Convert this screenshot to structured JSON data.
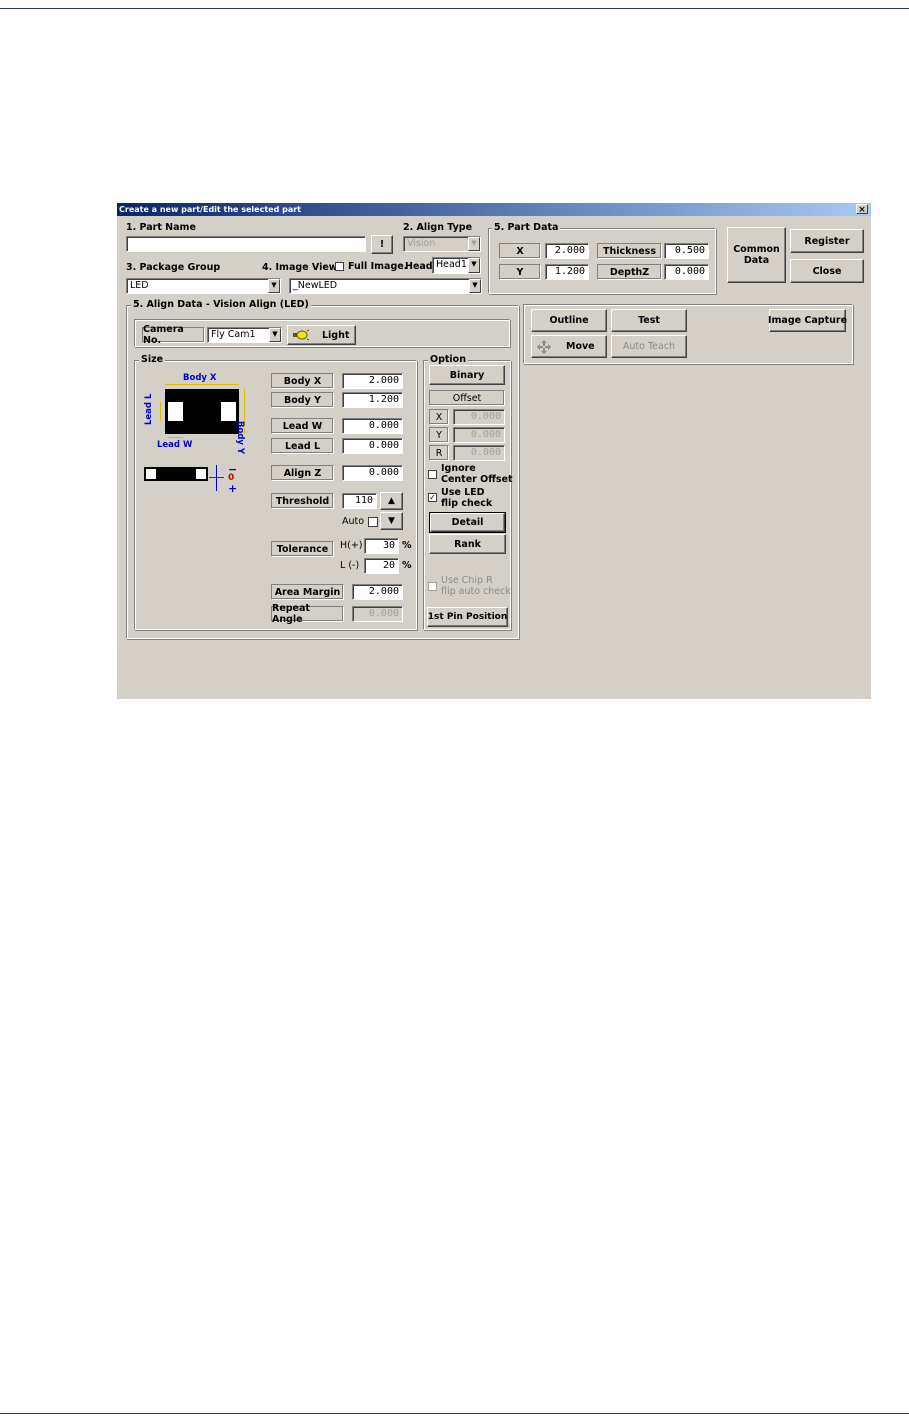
{
  "dialog": {
    "title": "Create a new part/Edit the selected part",
    "close_glyph": "×"
  },
  "part_name": {
    "label": "1. Part Name",
    "value": "",
    "bang_button": "!"
  },
  "align_type": {
    "label": "2. Align Type",
    "value": "Vision"
  },
  "package_group": {
    "label": "3. Package Group",
    "value": "LED"
  },
  "image_view": {
    "label": "4. Image View",
    "full_image_label": "Full Image.",
    "head_label": "Head",
    "head_value": "Head1",
    "value": "_NewLED"
  },
  "part_data": {
    "label": "5. Part Data",
    "x_label": "X",
    "x_value": "2.000",
    "y_label": "Y",
    "y_value": "1.200",
    "thickness_label": "Thickness",
    "thickness_value": "0.500",
    "depthz_label": "DepthZ",
    "depthz_value": "0.000"
  },
  "buttons": {
    "common_data_line1": "Common",
    "common_data_line2": "Data",
    "register": "Register",
    "close": "Close",
    "outline": "Outline",
    "test": "Test",
    "image_capture": "Image Capture",
    "move": "Move",
    "auto_teach": "Auto Teach",
    "binary": "Binary",
    "detail": "Detail",
    "rank": "Rank",
    "first_pin": "1st Pin Position"
  },
  "align_data": {
    "label": "5. Align Data - Vision Align (LED)",
    "camera_label": "Camera No.",
    "camera_value": "Fly Cam1",
    "light_label": "Light",
    "size_label": "Size",
    "diagram": {
      "body_x": "Body X",
      "body_y": "Body Y",
      "lead_l": "Lead L",
      "lead_w": "Lead W",
      "minus": "−",
      "zero": "0",
      "plus": "+"
    },
    "body_x_label": "Body X",
    "body_x_value": "2.000",
    "body_y_label": "Body Y",
    "body_y_value": "1.200",
    "lead_w_label": "Lead W",
    "lead_w_value": "0.000",
    "lead_l_label": "Lead L",
    "lead_l_value": "0.000",
    "align_z_label": "Align Z",
    "align_z_value": "0.000",
    "threshold_label": "Threshold",
    "threshold_value": "110",
    "auto_label": "Auto",
    "tolerance_label": "Tolerance",
    "h_label": "H(+)",
    "h_value": "30",
    "l_label": "L (-)",
    "l_value": "20",
    "percent": "%",
    "area_margin_label": "Area Margin",
    "area_margin_value": "2.000",
    "repeat_angle_label": "Repeat Angle",
    "repeat_angle_value": "0.000"
  },
  "option": {
    "label": "Option",
    "offset_label": "Offset",
    "x_label": "X",
    "x_value": "0.000",
    "y_label": "Y",
    "y_value": "0.000",
    "r_label": "R",
    "r_value": "0.000",
    "ignore_line1": "Ignore",
    "ignore_line2": "Center Offset",
    "use_led_line1": "Use LED",
    "use_led_line2": "flip check",
    "chip_line1": "Use Chip R",
    "chip_line2": "flip auto check",
    "check_mark": "✓"
  }
}
